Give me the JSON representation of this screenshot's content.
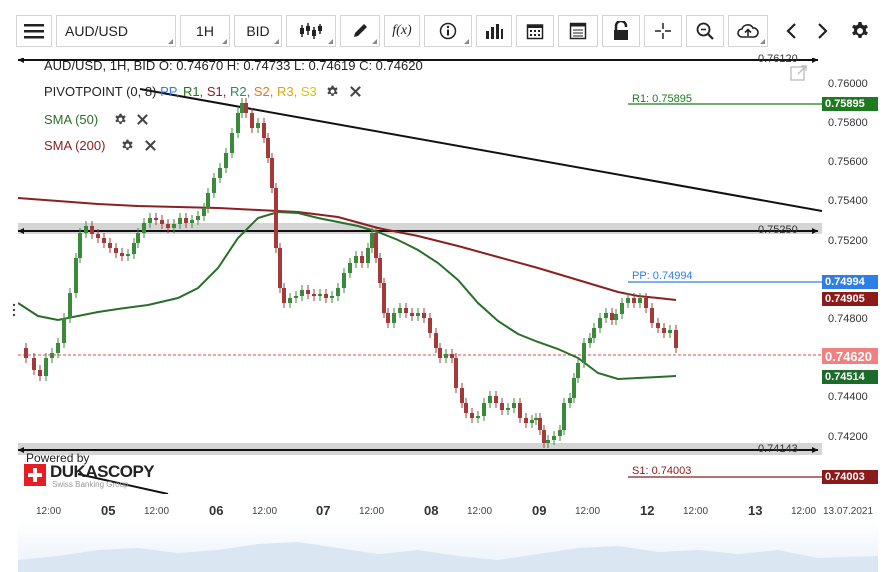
{
  "toolbar": {
    "symbol": "AUD/USD",
    "timeframe": "1H",
    "price_type": "BID",
    "fx_label": "f(x)"
  },
  "chart": {
    "info_line": "AUD/USD, 1H, BID   O: 0.74670 H: 0.74733 L: 0.74619 C: 0.74620",
    "pivot": {
      "name": "PIVOTPOINT (0, 8)",
      "pp": "PP,",
      "r1": "R1,",
      "s1": "S1,",
      "r2": "R2,",
      "s2": "S2,",
      "r3": "R3,",
      "s3": "S3"
    },
    "sma50": "SMA (50)",
    "sma200": "SMA (200)",
    "powered_by": "Powered by",
    "brand": "DUKASCOPY",
    "brand_sub": "Swiss Banking Group",
    "levels": {
      "top": "0.76120",
      "mid": "0.75250",
      "low": "0.74143",
      "r1": "R1: 0.75895",
      "pp": "PP: 0.74994",
      "s1": "S1: 0.74003"
    }
  },
  "y_axis": {
    "ticks": [
      "0.76000",
      "0.75800",
      "0.75600",
      "0.75400",
      "0.75200",
      "0.74800",
      "0.74400",
      "0.74200"
    ],
    "tags": {
      "r1": "0.75895",
      "pp": "0.74994",
      "sma200": "0.74905",
      "last": "0.74620",
      "sma50": "0.74514",
      "s1": "0.74003"
    }
  },
  "x_axis": {
    "labels": [
      "12:00",
      "05",
      "12:00",
      "06",
      "12:00",
      "07",
      "12:00",
      "08",
      "12:00",
      "09",
      "12:00",
      "12",
      "12:00",
      "13",
      "12:00",
      "13.07.2021"
    ]
  },
  "colors": {
    "r1": "#1f7a1f",
    "pp": "#2f7ee8",
    "sma200": "#8b1a1a",
    "last": "#f28080",
    "sma50": "#1c6b2a",
    "s1": "#8b1a1a",
    "bull": "#3b8a3b",
    "bear": "#a33a3a"
  }
}
